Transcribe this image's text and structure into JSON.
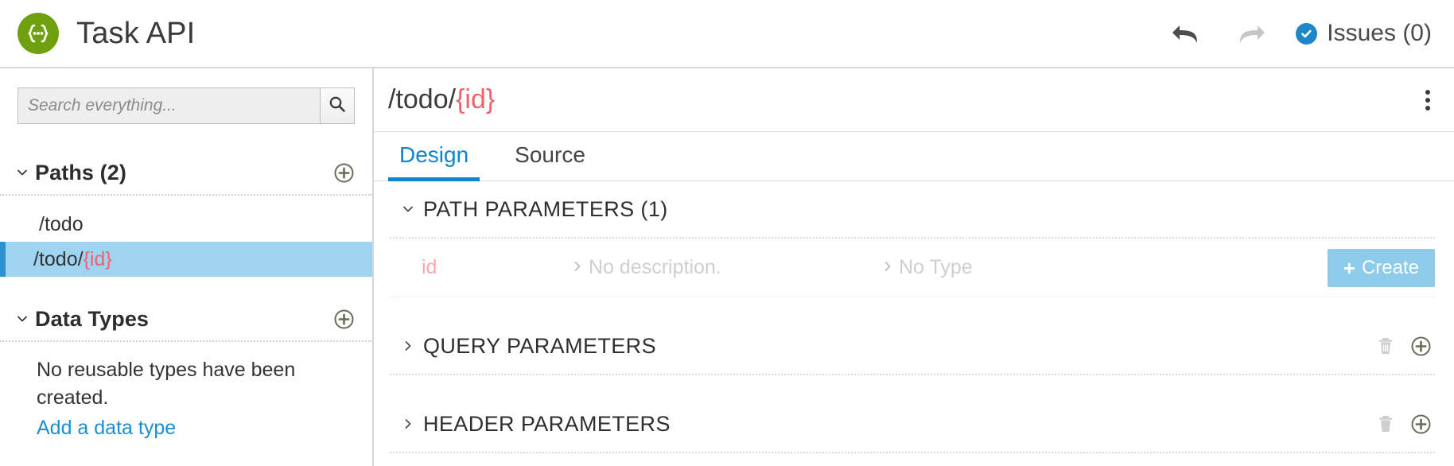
{
  "header": {
    "logo_icon": "api-braces-logo-icon",
    "title": "Task API",
    "undo_icon": "undo-arrow-icon",
    "redo_icon": "redo-arrow-icon",
    "issues_icon": "check-circle-icon",
    "issues_label": "Issues (0)",
    "accent_blue": "#1e87c8",
    "logo_green": "#6fa10e"
  },
  "sidebar": {
    "search": {
      "placeholder": "Search everything...",
      "value": "",
      "button_icon": "search-icon"
    },
    "paths_section": {
      "title": "Paths (2)",
      "chevron_icon": "chevron-down-icon",
      "add_icon": "plus-circle-icon",
      "items": [
        {
          "prefix": "/todo",
          "param": "",
          "selected": false
        },
        {
          "prefix": "/todo/",
          "param": "{id}",
          "selected": true
        }
      ]
    },
    "data_types_section": {
      "title": "Data Types",
      "chevron_icon": "chevron-down-icon",
      "add_icon": "plus-circle-icon",
      "empty_text": "No reusable types have been created.",
      "link_text": "Add a data type"
    }
  },
  "main": {
    "path_prefix": "/todo/",
    "path_param": "{id}",
    "menu_icon": "kebab-menu-icon",
    "tabs": [
      {
        "label": "Design",
        "active": true
      },
      {
        "label": "Source",
        "active": false
      }
    ],
    "groups": [
      {
        "title": "PATH PARAMETERS (1)",
        "chevron_icon": "chevron-down-icon",
        "expanded": true,
        "rows": [
          {
            "name": "id",
            "description": "No description.",
            "type": "No Type",
            "chevron_icon": "chevron-right-icon",
            "create_label": "Create",
            "create_plus": "+"
          }
        ]
      },
      {
        "title": "QUERY PARAMETERS",
        "chevron_icon": "chevron-right-icon",
        "expanded": false,
        "delete_icon": "trash-icon",
        "add_icon": "plus-circle-icon"
      },
      {
        "title": "HEADER PARAMETERS",
        "chevron_icon": "chevron-right-icon",
        "expanded": false,
        "delete_icon": "trash-icon",
        "add_icon": "plus-circle-icon"
      }
    ]
  },
  "colors": {
    "param_red": "#f4616e",
    "tab_active_blue": "#0d85cd",
    "selection_blue": "#9ed4f0",
    "create_button_blue": "#8ecbeb",
    "link_blue": "#1a8fd4"
  }
}
